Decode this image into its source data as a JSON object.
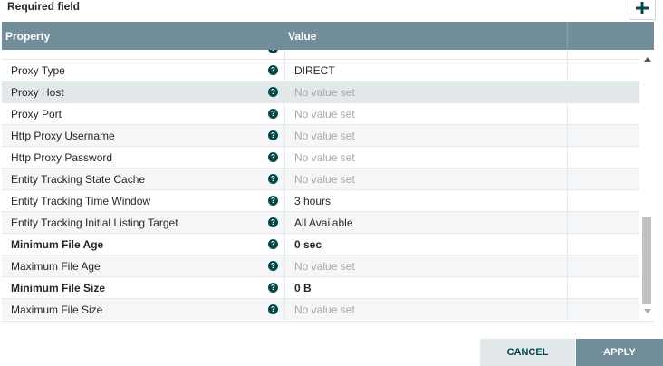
{
  "required_label": "Required field",
  "grid": {
    "header_property": "Property",
    "header_value": "Value",
    "rows": [
      {
        "property": "Proxy Type",
        "value": "DIRECT",
        "unset": false,
        "required": false
      },
      {
        "property": "Proxy Host",
        "value": "No value set",
        "unset": true,
        "required": false
      },
      {
        "property": "Proxy Port",
        "value": "No value set",
        "unset": true,
        "required": false
      },
      {
        "property": "Http Proxy Username",
        "value": "No value set",
        "unset": true,
        "required": false
      },
      {
        "property": "Http Proxy Password",
        "value": "No value set",
        "unset": true,
        "required": false
      },
      {
        "property": "Entity Tracking State Cache",
        "value": "No value set",
        "unset": true,
        "required": false
      },
      {
        "property": "Entity Tracking Time Window",
        "value": "3 hours",
        "unset": false,
        "required": false
      },
      {
        "property": "Entity Tracking Initial Listing Target",
        "value": "All Available",
        "unset": false,
        "required": false
      },
      {
        "property": "Minimum File Age",
        "value": "0 sec",
        "unset": false,
        "required": true
      },
      {
        "property": "Maximum File Age",
        "value": "No value set",
        "unset": true,
        "required": false
      },
      {
        "property": "Minimum File Size",
        "value": "0 B",
        "unset": false,
        "required": true
      },
      {
        "property": "Maximum File Size",
        "value": "No value set",
        "unset": true,
        "required": false
      }
    ]
  },
  "buttons": {
    "cancel": "CANCEL",
    "apply": "APPLY"
  },
  "colors": {
    "header_bg": "#728e9b",
    "help_icon": "#004849"
  }
}
